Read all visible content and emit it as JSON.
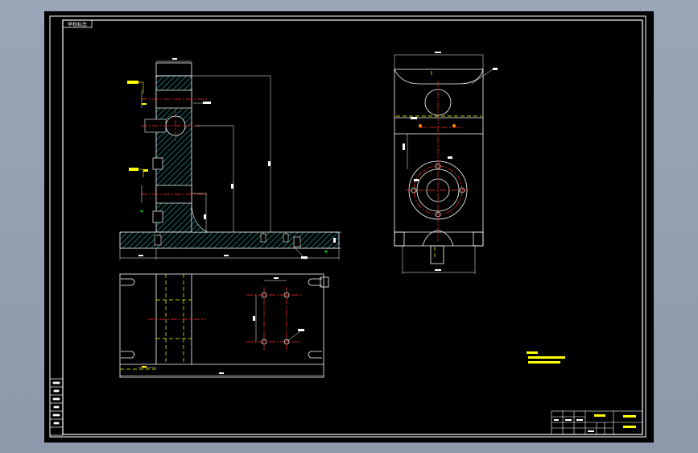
{
  "app": {
    "background": "#9aa6b8",
    "canvas_bg": "#000000"
  },
  "colors": {
    "frame": "#ffffff",
    "section": "#1a8a8a",
    "center": "#ff2b2b",
    "hidden": "#ffff00",
    "dimension": "#ffffff",
    "note": "#ffff00",
    "leader_tag": "#00cc00"
  },
  "sheet": {
    "code_tag": "学校标志"
  },
  "icons": {
    "section_hatch": "hatch-icon",
    "surface_finish": "roughness-symbol-icon"
  }
}
